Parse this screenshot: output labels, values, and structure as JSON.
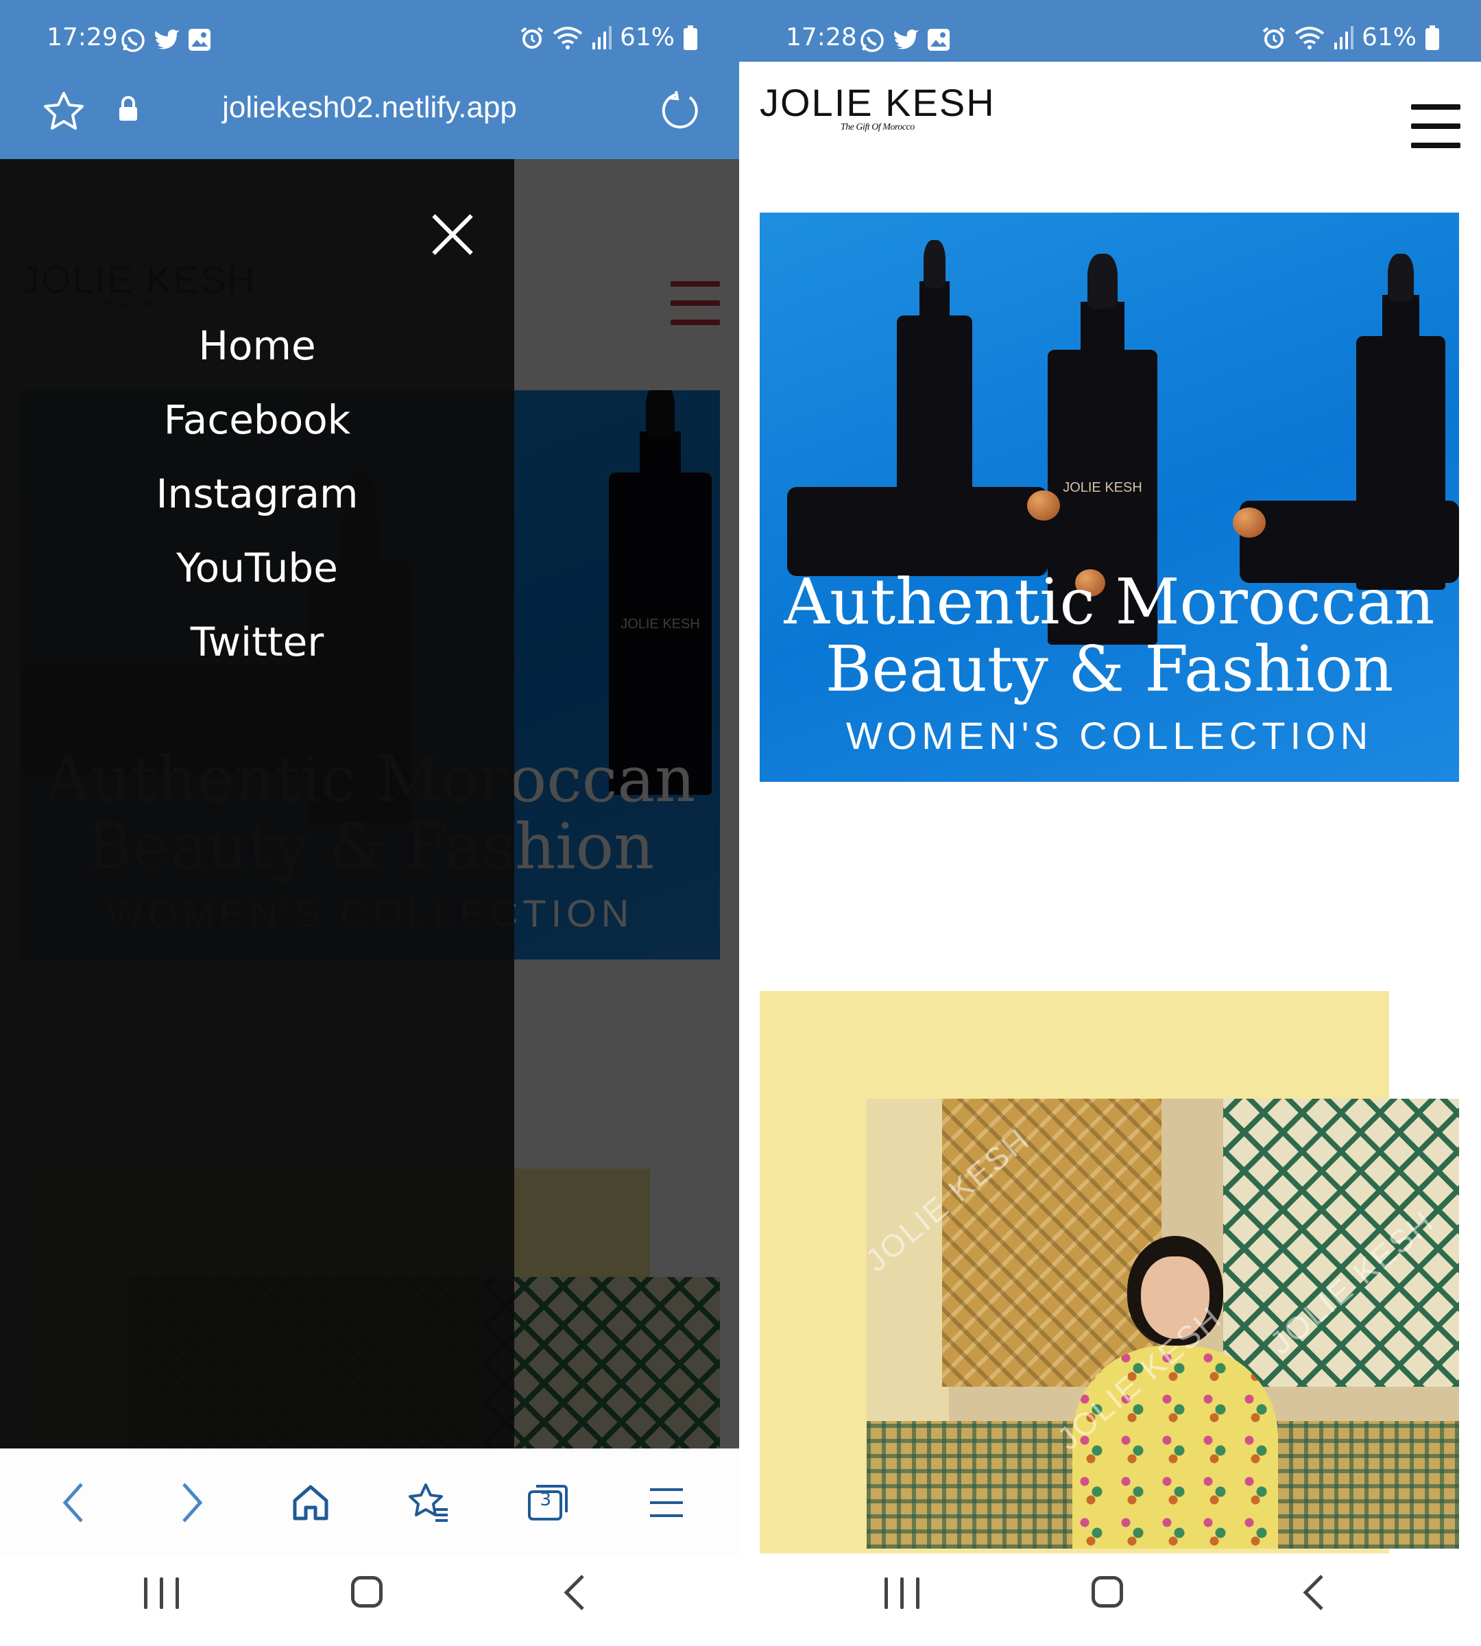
{
  "left_screen": {
    "status_bar": {
      "time": "17:29",
      "notification_icons": [
        "whatsapp-icon",
        "twitter-icon",
        "gallery-icon"
      ],
      "system_icons": [
        "alarm-icon",
        "wifi-icon",
        "signal-icon",
        "battery-icon"
      ],
      "battery": "61%"
    },
    "browser": {
      "url": "joliekesh02.netlify.app"
    },
    "drawer": {
      "items": [
        {
          "label": "Home"
        },
        {
          "label": "Facebook"
        },
        {
          "label": "Instagram"
        },
        {
          "label": "YouTube"
        },
        {
          "label": "Twitter"
        }
      ]
    },
    "toolbar": {
      "tabs_count": "3"
    }
  },
  "right_screen": {
    "status_bar": {
      "time": "17:28",
      "battery": "61%"
    }
  },
  "site": {
    "logo": {
      "name": "JOLIE KESH",
      "tagline": "The Gift Of Morocco"
    },
    "hero": {
      "title_line1": "Authentic Moroccan",
      "title_line2": "Beauty & Fashion",
      "subtitle": "WOMEN'S COLLECTION",
      "bottle_label": "JOLIE KESH"
    },
    "photo_watermark": "JOLIE KESH"
  },
  "colors": {
    "browser_bar": "#4a86c5",
    "hero_blue": "#0a77d4",
    "accent_yellow": "#f6e79e",
    "drawer_bg": "#0c0c0c",
    "dimmed_hamburger": "#7a1e22"
  }
}
